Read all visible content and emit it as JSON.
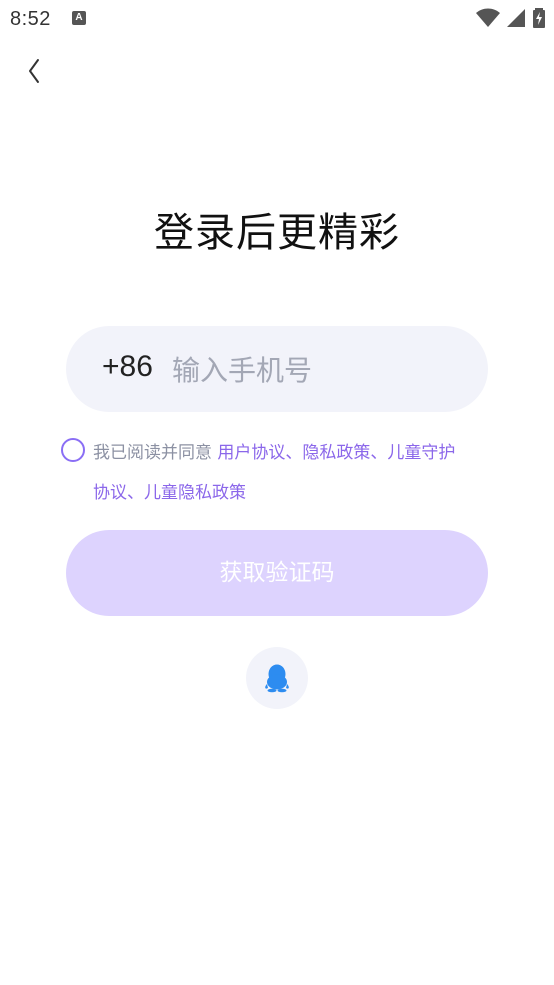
{
  "status_bar": {
    "time": "8:52",
    "notification_icon": "a-letter-icon",
    "icons": [
      "wifi-icon",
      "signal-icon",
      "battery-charging-icon"
    ]
  },
  "nav": {
    "back_icon": "chevron-left-icon"
  },
  "title": "登录后更精彩",
  "phone": {
    "country_code": "+86",
    "placeholder": "输入手机号",
    "value": ""
  },
  "agreement": {
    "checked": false,
    "prefix": "我已阅读并同意 ",
    "links": [
      "用户协议",
      "隐私政策",
      "儿童守护协议",
      "儿童隐私政策"
    ],
    "separator": "、",
    "line1_parts": [
      "用户协议",
      "、",
      "隐私政策",
      "、",
      "儿童守护"
    ],
    "line2_parts": [
      "协议",
      "、",
      "儿童隐私政策"
    ]
  },
  "buttons": {
    "get_code": "获取验证码",
    "qq_login_icon": "qq-penguin-icon"
  },
  "colors": {
    "accent": "#8b67ea",
    "button_disabled": "#ddd3fe",
    "input_bg": "#f2f3fa",
    "qq_blue": "#2d8cf0"
  }
}
